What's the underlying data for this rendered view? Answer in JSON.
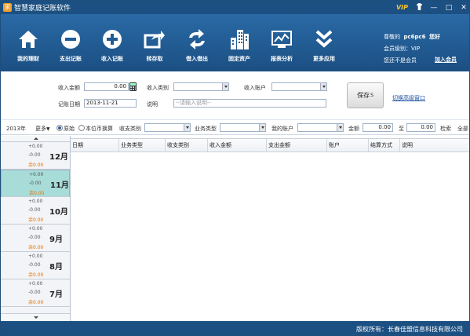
{
  "window": {
    "title": "智慧家庭记账软件",
    "vip": "VIP",
    "min": "—",
    "max": "□",
    "close": "✕",
    "logo": "家"
  },
  "toolbar": {
    "items": [
      {
        "label": "我的理财",
        "icon": "home-icon"
      },
      {
        "label": "支出记账",
        "icon": "minus-circle-icon"
      },
      {
        "label": "收入记账",
        "icon": "plus-circle-icon"
      },
      {
        "label": "转存取",
        "icon": "transfer-icon"
      },
      {
        "label": "借入借出",
        "icon": "exchange-icon"
      },
      {
        "label": "固定资产",
        "icon": "building-icon"
      },
      {
        "label": "报表分析",
        "icon": "chart-icon"
      },
      {
        "label": "更多应用",
        "icon": "chevron-down-double-icon"
      }
    ]
  },
  "user": {
    "greeting": "尊敬的",
    "name": "pc6pc6",
    "hello": "您好",
    "level_label": "会员级别：",
    "level_value": "VIP",
    "status": "您还不是会员",
    "join": "加入会员"
  },
  "form": {
    "amount_label": "收入金额",
    "amount_value": "0.00",
    "category_label": "收入类别",
    "account_label": "收入账户",
    "date_label": "记账日期",
    "date_value": "2013-11-21",
    "note_label": "说明",
    "note_placeholder": "--请输入说明--",
    "save": "保存",
    "save_key": "S",
    "advanced": "切换高级窗口"
  },
  "filter": {
    "year": "2013年",
    "more": "更多",
    "radio_original": "原始",
    "radio_convert": "本位币换算",
    "type_label": "收支类别",
    "biz_label": "业务类型",
    "account_label": "我的账户",
    "amount_label": "金额",
    "from": "0.00",
    "to_label": "至",
    "to": "0.00",
    "search": "检索",
    "all": "全部"
  },
  "months": [
    {
      "name": "12月",
      "income": "+0.00",
      "expense": "-0.00",
      "balance": "0.00"
    },
    {
      "name": "11月",
      "income": "+0.00",
      "expense": "-0.00",
      "balance": "0.00"
    },
    {
      "name": "10月",
      "income": "+0.00",
      "expense": "-0.00",
      "balance": "0.00"
    },
    {
      "name": "9月",
      "income": "+0.00",
      "expense": "-0.00",
      "balance": "0.00"
    },
    {
      "name": "8月",
      "income": "+0.00",
      "expense": "-0.00",
      "balance": "0.00"
    },
    {
      "name": "7月",
      "income": "+0.00",
      "expense": "-0.00",
      "balance": "0.00"
    }
  ],
  "balance_prefix": "余",
  "table": {
    "columns": [
      "日期",
      "业务类型",
      "收支类别",
      "收入金额",
      "支出金额",
      "账户",
      "结算方式",
      "说明"
    ]
  },
  "footer": {
    "copyright": "版权所有：长春佳盟信息科技有限公司"
  }
}
